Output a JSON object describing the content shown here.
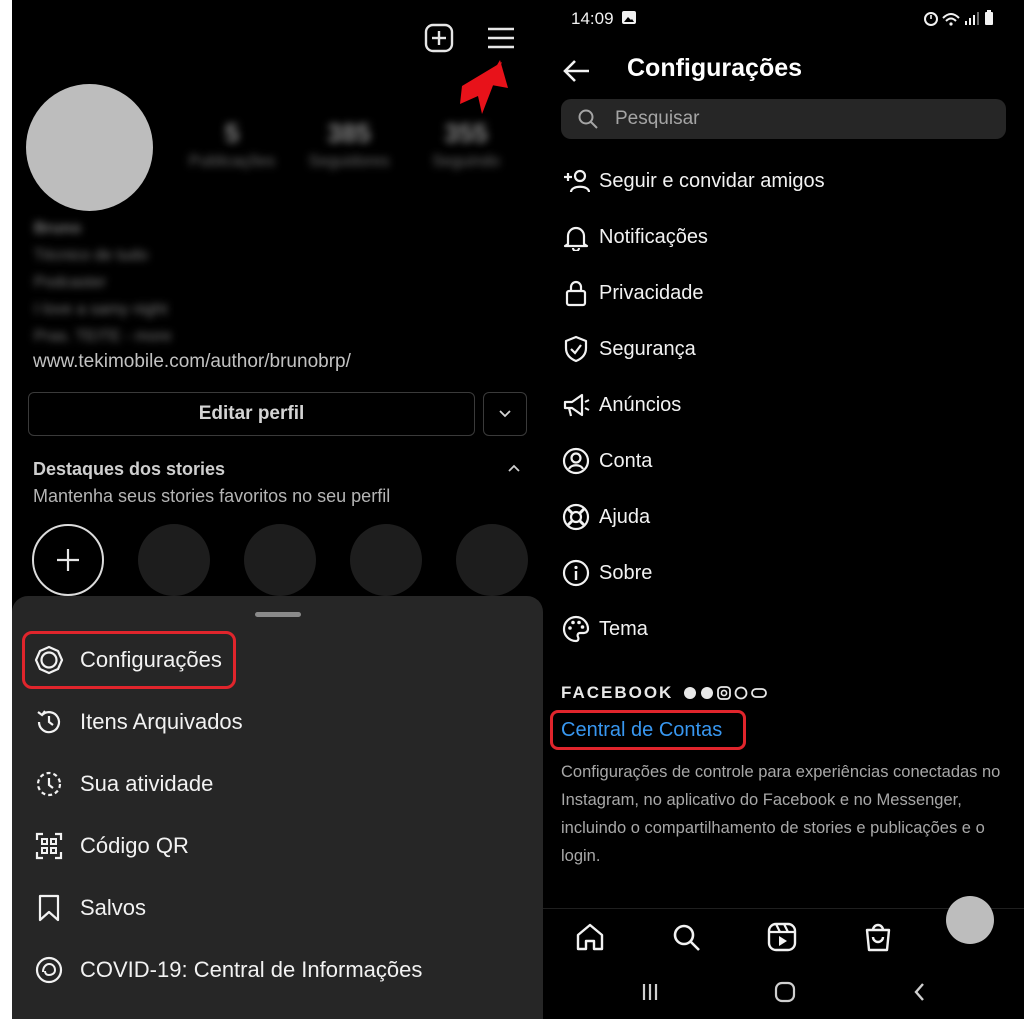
{
  "left": {
    "stats": [
      {
        "num": "5",
        "label": "Publicações"
      },
      {
        "num": "385",
        "label": "Seguidores"
      },
      {
        "num": "355",
        "label": "Seguindo"
      }
    ],
    "bio_lines": [
      "Bruno",
      "Técnico de tudo",
      "Podcaster",
      "I love a samy night",
      "Pras. TEITE - more"
    ],
    "link": "www.tekimobile.com/author/brunobrp/",
    "edit_profile": "Editar perfil",
    "highlights_title": "Destaques dos stories",
    "highlights_sub": "Mantenha seus stories favoritos no seu perfil",
    "menu": [
      {
        "label": "Configurações",
        "icon": "settings-gear-icon"
      },
      {
        "label": "Itens Arquivados",
        "icon": "archive-history-icon"
      },
      {
        "label": "Sua atividade",
        "icon": "activity-clock-icon"
      },
      {
        "label": "Código QR",
        "icon": "qr-code-icon"
      },
      {
        "label": "Salvos",
        "icon": "bookmark-icon"
      },
      {
        "label": "COVID-19: Central de Informações",
        "icon": "covid-info-icon"
      }
    ]
  },
  "right": {
    "status_time": "14:09",
    "title": "Configurações",
    "search_placeholder": "Pesquisar",
    "items": [
      {
        "label": "Seguir e convidar amigos",
        "icon": "add-person-icon"
      },
      {
        "label": "Notificações",
        "icon": "bell-icon"
      },
      {
        "label": "Privacidade",
        "icon": "lock-icon"
      },
      {
        "label": "Segurança",
        "icon": "shield-check-icon"
      },
      {
        "label": "Anúncios",
        "icon": "megaphone-icon"
      },
      {
        "label": "Conta",
        "icon": "account-circle-icon"
      },
      {
        "label": "Ajuda",
        "icon": "lifebuoy-icon"
      },
      {
        "label": "Sobre",
        "icon": "info-icon"
      },
      {
        "label": "Tema",
        "icon": "palette-icon"
      }
    ],
    "facebook_label": "FACEBOOK",
    "accounts_center": "Central de Contas",
    "accounts_center_desc": "Configurações de controle para experiências conectadas no Instagram, no aplicativo do Facebook e no Messenger, incluindo o compartilhamento de stories e publicações e o login."
  },
  "colors": {
    "highlight": "#e0252c",
    "link": "#3897f0",
    "sheet": "#262626"
  }
}
